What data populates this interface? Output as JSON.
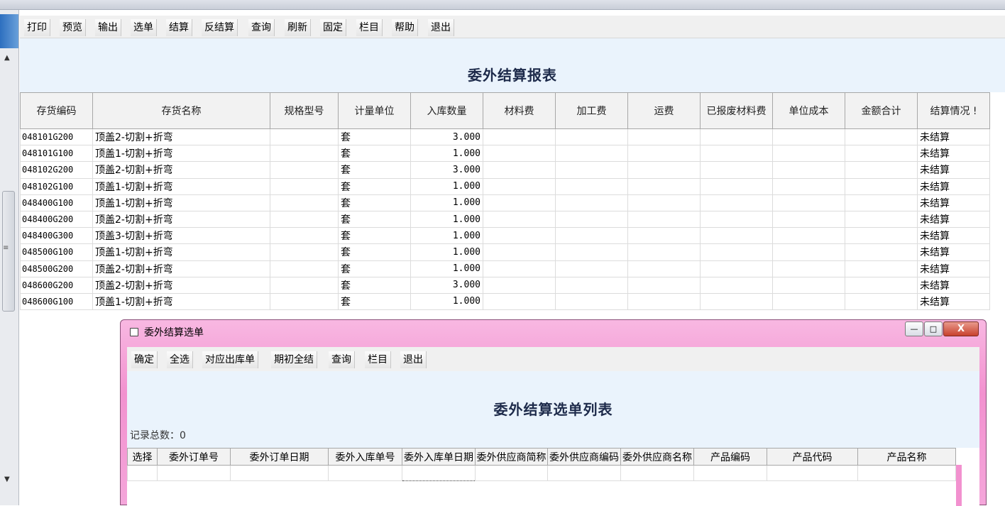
{
  "toolbar": {
    "print": "打印",
    "preview": "预览",
    "export": "输出",
    "select": "选单",
    "settle": "结算",
    "unsettle": "反结算",
    "query": "查询",
    "refresh": "刷新",
    "fix": "固定",
    "columns": "栏目",
    "help": "帮助",
    "exit": "退出"
  },
  "report": {
    "title": "委外结算报表",
    "headers": [
      "存货编码",
      "存货名称",
      "规格型号",
      "计量单位",
      "入库数量",
      "材料费",
      "加工费",
      "运费",
      "已报废材料费",
      "单位成本",
      "金额合计",
      "结算情况"
    ],
    "header_overflow": "!",
    "rows": [
      {
        "code": "048101G200",
        "name": "顶盖2-切割+折弯",
        "unit": "套",
        "qty": "3.000",
        "status": "未结算"
      },
      {
        "code": "048101G100",
        "name": "顶盖1-切割+折弯",
        "unit": "套",
        "qty": "1.000",
        "status": "未结算"
      },
      {
        "code": "048102G200",
        "name": "顶盖2-切割+折弯",
        "unit": "套",
        "qty": "3.000",
        "status": "未结算"
      },
      {
        "code": "048102G100",
        "name": "顶盖1-切割+折弯",
        "unit": "套",
        "qty": "1.000",
        "status": "未结算"
      },
      {
        "code": "048400G100",
        "name": "顶盖1-切割+折弯",
        "unit": "套",
        "qty": "1.000",
        "status": "未结算"
      },
      {
        "code": "048400G200",
        "name": "顶盖2-切割+折弯",
        "unit": "套",
        "qty": "1.000",
        "status": "未结算"
      },
      {
        "code": "048400G300",
        "name": "顶盖3-切割+折弯",
        "unit": "套",
        "qty": "1.000",
        "status": "未结算"
      },
      {
        "code": "048500G100",
        "name": "顶盖1-切割+折弯",
        "unit": "套",
        "qty": "1.000",
        "status": "未结算"
      },
      {
        "code": "048500G200",
        "name": "顶盖2-切割+折弯",
        "unit": "套",
        "qty": "1.000",
        "status": "未结算"
      },
      {
        "code": "048600G200",
        "name": "顶盖2-切割+折弯",
        "unit": "套",
        "qty": "3.000",
        "status": "未结算"
      },
      {
        "code": "048600G100",
        "name": "顶盖1-切割+折弯",
        "unit": "套",
        "qty": "1.000",
        "status": "未结算"
      }
    ]
  },
  "dialog": {
    "window_title": "委外结算选单",
    "toolbar": {
      "confirm": "确定",
      "select_all": "全选",
      "matching_outbound": "对应出库单",
      "initial_settle": "期初全结",
      "query": "查询",
      "columns": "栏目",
      "exit": "退出"
    },
    "list_title": "委外结算选单列表",
    "record_count_label": "记录总数：0",
    "headers": [
      "选择",
      "委外订单号",
      "委外订单日期",
      "委外入库单号",
      "委外入库单日期",
      "委外供应商简称",
      "委外供应商编码",
      "委外供应商名称",
      "产品编码",
      "产品代码",
      "产品名称"
    ],
    "window_buttons": {
      "minimize": "—",
      "maximize": "□",
      "close": "X"
    }
  },
  "icons": [
    "scroll-up-arrow-icon",
    "scroll-down-arrow-icon",
    "scroll-grip-icon",
    "document-icon"
  ],
  "colors": {
    "dialog_frame": "#f291cf",
    "report_header_bg": "#eaf3fc",
    "title_text": "#1d2a4a"
  }
}
